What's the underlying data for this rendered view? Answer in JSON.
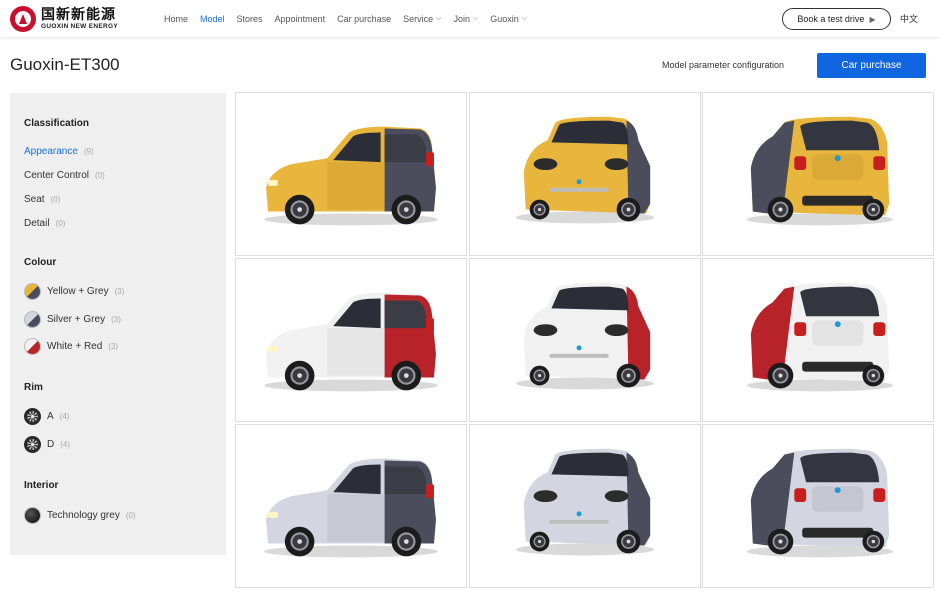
{
  "brand": {
    "name_cn": "国新新能源",
    "name_en": "GUOXIN NEW ENERGY"
  },
  "nav": {
    "items": [
      {
        "label": "Home",
        "active": false,
        "dropdown": false
      },
      {
        "label": "Model",
        "active": true,
        "dropdown": false
      },
      {
        "label": "Stores",
        "active": false,
        "dropdown": false
      },
      {
        "label": "Appointment",
        "active": false,
        "dropdown": false
      },
      {
        "label": "Car purchase",
        "active": false,
        "dropdown": false
      },
      {
        "label": "Service",
        "active": false,
        "dropdown": true
      },
      {
        "label": "Join",
        "active": false,
        "dropdown": true
      },
      {
        "label": "Guoxin",
        "active": false,
        "dropdown": true
      }
    ],
    "test_drive_label": "Book a test drive",
    "language": "中文"
  },
  "header": {
    "title": "Guoxin-ET300",
    "param_link": "Model parameter configuration",
    "purchase_label": "Car purchase"
  },
  "sidebar": {
    "classification": {
      "title": "Classification",
      "items": [
        {
          "label": "Appearance",
          "count": "(9)",
          "active": true
        },
        {
          "label": "Center Control",
          "count": "(0)",
          "active": false
        },
        {
          "label": "Seat",
          "count": "(0)",
          "active": false
        },
        {
          "label": "Detail",
          "count": "(0)",
          "active": false
        }
      ]
    },
    "colour": {
      "title": "Colour",
      "items": [
        {
          "label": "Yellow + Grey",
          "count": "(3)",
          "swatch": "yellow-grey"
        },
        {
          "label": "Silver + Grey",
          "count": "(3)",
          "swatch": "silver-grey"
        },
        {
          "label": "White + Red",
          "count": "(3)",
          "swatch": "white-red"
        }
      ]
    },
    "rim": {
      "title": "Rim",
      "items": [
        {
          "label": "A",
          "count": "(4)",
          "icon": "rim-icon"
        },
        {
          "label": "D",
          "count": "(4)",
          "icon": "rim-icon"
        }
      ]
    },
    "interior": {
      "title": "Interior",
      "items": [
        {
          "label": "Technology grey",
          "count": "(0)",
          "swatch": "technology-grey"
        }
      ]
    }
  },
  "gallery": {
    "colors": {
      "yellow": {
        "body": "#e8b63c",
        "shade": "#c9952a",
        "accent": "#4b4c5c"
      },
      "red": {
        "body": "#f1f1f1",
        "shade": "#d0d0d0",
        "accent": "#b8232a"
      },
      "silver": {
        "body": "#d3d6e0",
        "shade": "#aeb2be",
        "accent": "#4b4c5c"
      }
    },
    "tiles": [
      {
        "car": "yellow",
        "view": "side"
      },
      {
        "car": "yellow",
        "view": "front"
      },
      {
        "car": "yellow",
        "view": "rear"
      },
      {
        "car": "red",
        "view": "side"
      },
      {
        "car": "red",
        "view": "front"
      },
      {
        "car": "red",
        "view": "rear"
      },
      {
        "car": "silver",
        "view": "side"
      },
      {
        "car": "silver",
        "view": "front"
      },
      {
        "car": "silver",
        "view": "rear"
      }
    ]
  }
}
